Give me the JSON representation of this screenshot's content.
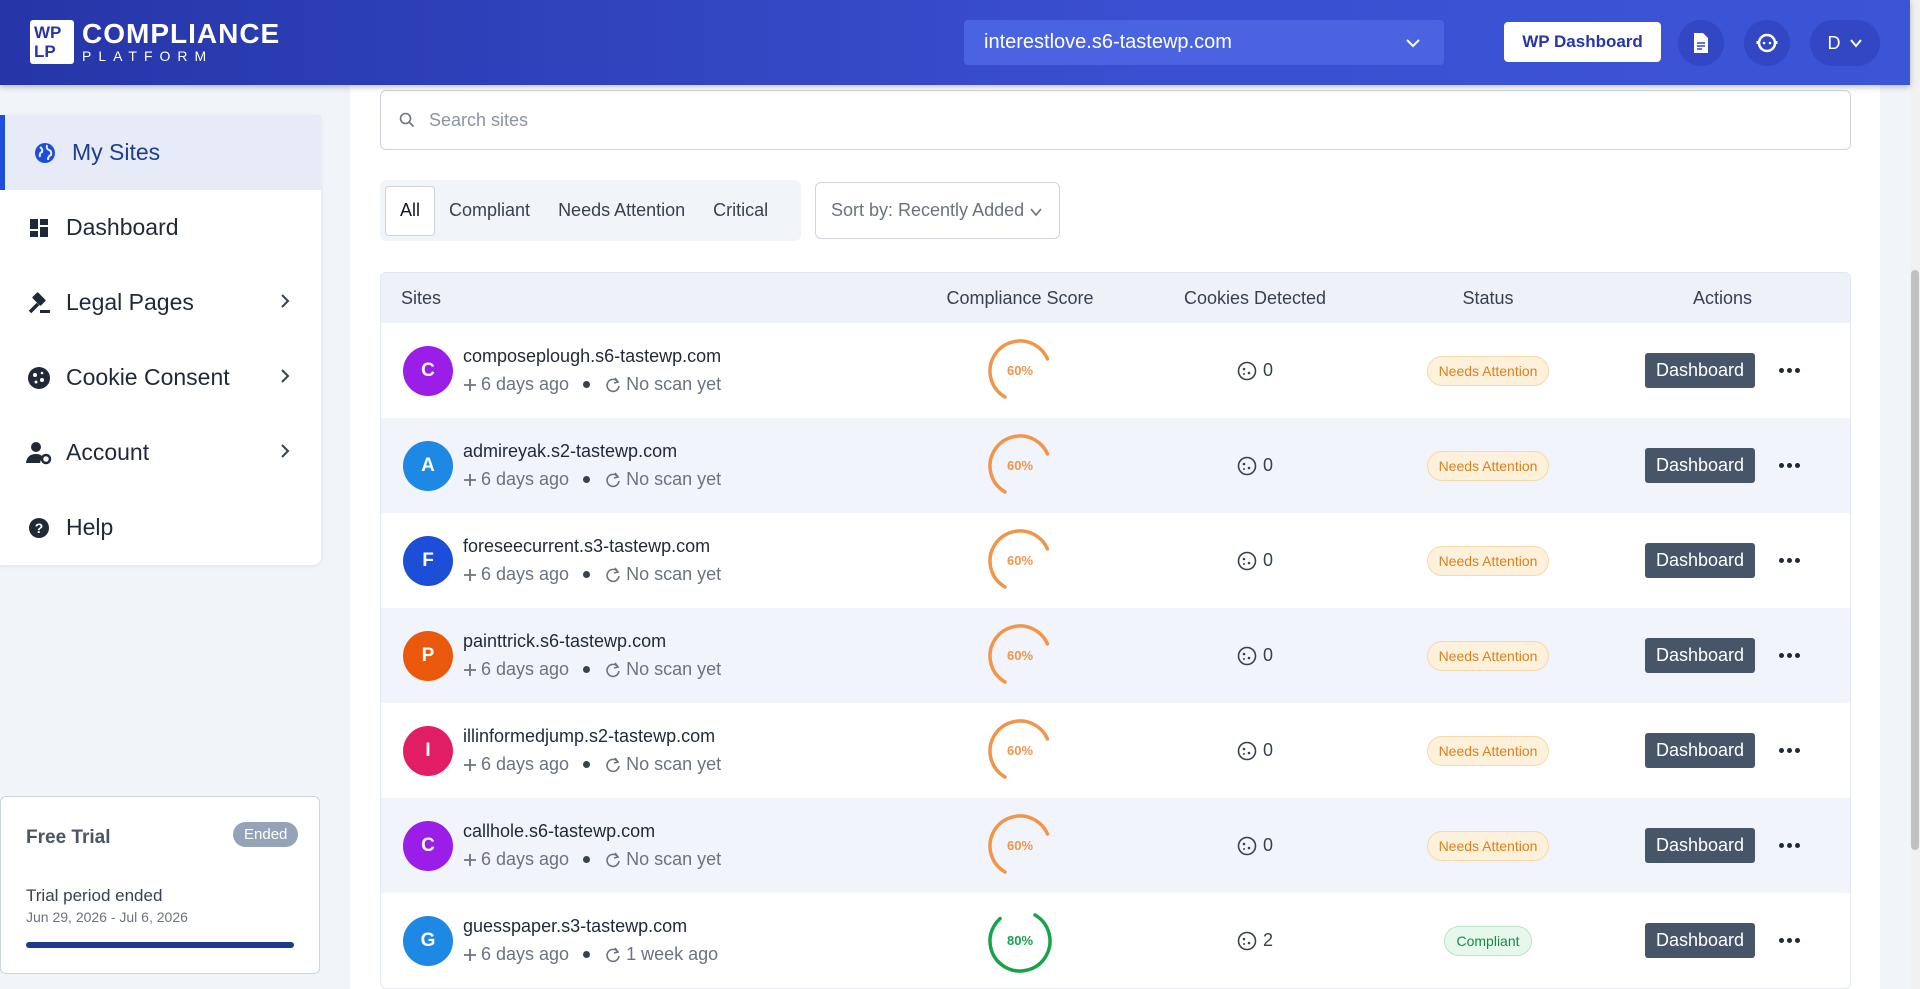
{
  "header": {
    "logo_mark": [
      "WP",
      "LP"
    ],
    "logo_line1": "COMPLIANCE",
    "logo_line2": "PLATFORM",
    "selected_site": "interestlove.s6-tastewp.com",
    "wp_dashboard_label": "WP Dashboard",
    "user_initial": "D"
  },
  "sidebar": {
    "items": [
      {
        "label": "My Sites",
        "icon": "globe-icon",
        "active": true
      },
      {
        "label": "Dashboard",
        "icon": "dashboard-icon"
      },
      {
        "label": "Legal Pages",
        "icon": "gavel-icon",
        "has_submenu": true
      },
      {
        "label": "Cookie Consent",
        "icon": "cookie-icon",
        "has_submenu": true
      },
      {
        "label": "Account",
        "icon": "user-cog-icon",
        "has_submenu": true
      },
      {
        "label": "Help",
        "icon": "help-icon"
      }
    ],
    "trial": {
      "title": "Free Trial",
      "badge": "Ended",
      "subtitle": "Trial period ended",
      "dates": "Jun 29, 2026 - Jul 6, 2026",
      "progress": 1.0
    }
  },
  "search": {
    "placeholder": "Search sites"
  },
  "filters": [
    "All",
    "Compliant",
    "Needs Attention",
    "Critical"
  ],
  "sort": {
    "label": "Sort by: Recently Added"
  },
  "table": {
    "headers": [
      "Sites",
      "Compliance Score",
      "Cookies Detected",
      "Status",
      "Actions"
    ],
    "rows": [
      {
        "initial": "C",
        "color": "#9b1de8",
        "name": "composeplough.s6-tastewp.com",
        "added": "6 days ago",
        "scan": "No scan yet",
        "score": 60,
        "score_label": "60%",
        "cookies": "0",
        "status": "Needs Attention",
        "action": "Dashboard"
      },
      {
        "initial": "A",
        "color": "#1e88e5",
        "name": "admireyak.s2-tastewp.com",
        "added": "6 days ago",
        "scan": "No scan yet",
        "score": 60,
        "score_label": "60%",
        "cookies": "0",
        "status": "Needs Attention",
        "action": "Dashboard"
      },
      {
        "initial": "F",
        "color": "#1d4ed8",
        "name": "foreseecurrent.s3-tastewp.com",
        "added": "6 days ago",
        "scan": "No scan yet",
        "score": 60,
        "score_label": "60%",
        "cookies": "0",
        "status": "Needs Attention",
        "action": "Dashboard"
      },
      {
        "initial": "P",
        "color": "#ea580c",
        "name": "painttrick.s6-tastewp.com",
        "added": "6 days ago",
        "scan": "No scan yet",
        "score": 60,
        "score_label": "60%",
        "cookies": "0",
        "status": "Needs Attention",
        "action": "Dashboard"
      },
      {
        "initial": "I",
        "color": "#e11d64",
        "name": "illinformedjump.s2-tastewp.com",
        "added": "6 days ago",
        "scan": "No scan yet",
        "score": 60,
        "score_label": "60%",
        "cookies": "0",
        "status": "Needs Attention",
        "action": "Dashboard"
      },
      {
        "initial": "C",
        "color": "#9b1de8",
        "name": "callhole.s6-tastewp.com",
        "added": "6 days ago",
        "scan": "No scan yet",
        "score": 60,
        "score_label": "60%",
        "cookies": "0",
        "status": "Needs Attention",
        "action": "Dashboard"
      },
      {
        "initial": "G",
        "color": "#1e88e5",
        "name": "guesspaper.s3-tastewp.com",
        "added": "6 days ago",
        "scan": "1 week ago",
        "score": 80,
        "score_label": "80%",
        "cookies": "2",
        "status": "Compliant",
        "action": "Dashboard"
      }
    ]
  },
  "colors": {
    "warn": "#f0954a",
    "ok": "#16a34a",
    "brand": "#2636a8"
  }
}
